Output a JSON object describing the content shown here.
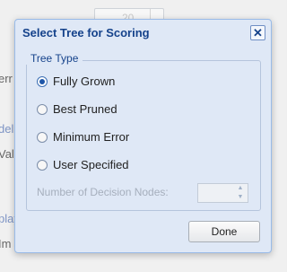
{
  "background": {
    "spinner_value": "20",
    "label_err": "err",
    "label_del": "del",
    "label_vali": "Vali",
    "label_play": "play",
    "label_im": "Im"
  },
  "dialog": {
    "title": "Select Tree for Scoring",
    "close_symbol": "✕",
    "fieldset_legend": "Tree Type",
    "options": [
      {
        "label": "Fully Grown",
        "checked": true
      },
      {
        "label": "Best Pruned",
        "checked": false
      },
      {
        "label": "Minimum Error",
        "checked": false
      },
      {
        "label": "User Specified",
        "checked": false
      }
    ],
    "decision_nodes_label": "Number of Decision Nodes:",
    "decision_nodes_value": "",
    "done_label": "Done"
  }
}
